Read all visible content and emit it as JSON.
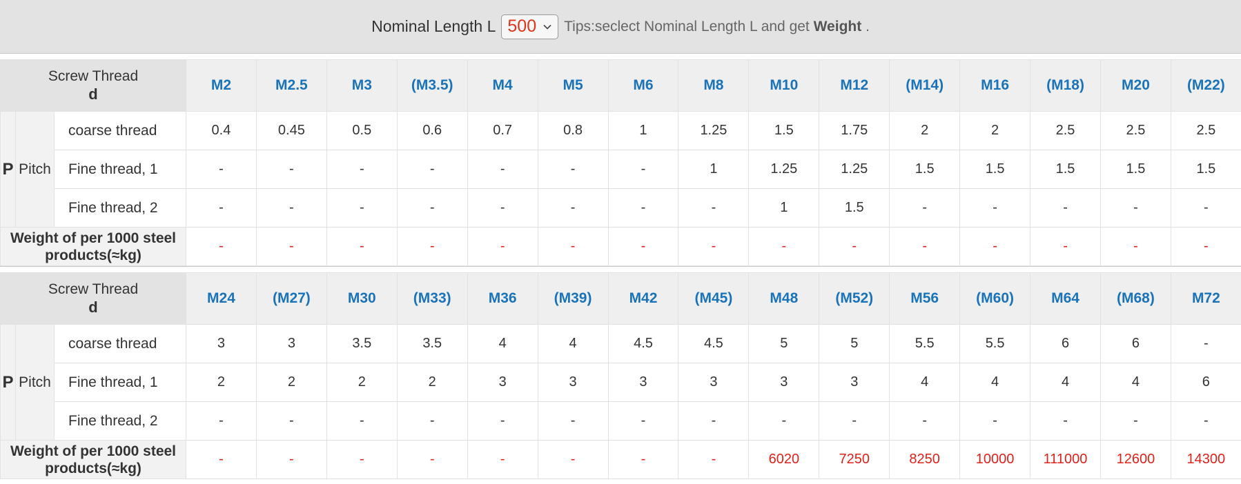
{
  "header": {
    "nominal_length_label": "Nominal Length L",
    "selected_length": "500",
    "tips_prefix": "Tips:seclect Nominal Length L and get",
    "tips_bold": "Weight",
    "tips_suffix": "."
  },
  "row_labels": {
    "screw_thread": "Screw Thread",
    "d": "d",
    "p": "P",
    "pitch": "Pitch",
    "coarse": "coarse thread",
    "fine1": "Fine thread, 1",
    "fine2": "Fine thread, 2",
    "weight": "Weight of per 1000 steel products(≈kg)"
  },
  "tables": [
    {
      "sizes": [
        "M2",
        "M2.5",
        "M3",
        "(M3.5)",
        "M4",
        "M5",
        "M6",
        "M8",
        "M10",
        "M12",
        "(M14)",
        "M16",
        "(M18)",
        "M20",
        "(M22)"
      ],
      "coarse": [
        "0.4",
        "0.45",
        "0.5",
        "0.6",
        "0.7",
        "0.8",
        "1",
        "1.25",
        "1.5",
        "1.75",
        "2",
        "2",
        "2.5",
        "2.5",
        "2.5"
      ],
      "fine1": [
        "-",
        "-",
        "-",
        "-",
        "-",
        "-",
        "-",
        "1",
        "1.25",
        "1.25",
        "1.5",
        "1.5",
        "1.5",
        "1.5",
        "1.5"
      ],
      "fine2": [
        "-",
        "-",
        "-",
        "-",
        "-",
        "-",
        "-",
        "-",
        "1",
        "1.5",
        "-",
        "-",
        "-",
        "-",
        "-"
      ],
      "weight": [
        "-",
        "-",
        "-",
        "-",
        "-",
        "-",
        "-",
        "-",
        "-",
        "-",
        "-",
        "-",
        "-",
        "-",
        "-"
      ]
    },
    {
      "sizes": [
        "M24",
        "(M27)",
        "M30",
        "(M33)",
        "M36",
        "(M39)",
        "M42",
        "(M45)",
        "M48",
        "(M52)",
        "M56",
        "(M60)",
        "M64",
        "(M68)",
        "M72"
      ],
      "coarse": [
        "3",
        "3",
        "3.5",
        "3.5",
        "4",
        "4",
        "4.5",
        "4.5",
        "5",
        "5",
        "5.5",
        "5.5",
        "6",
        "6",
        "-"
      ],
      "fine1": [
        "2",
        "2",
        "2",
        "2",
        "3",
        "3",
        "3",
        "3",
        "3",
        "3",
        "4",
        "4",
        "4",
        "4",
        "6"
      ],
      "fine2": [
        "-",
        "-",
        "-",
        "-",
        "-",
        "-",
        "-",
        "-",
        "-",
        "-",
        "-",
        "-",
        "-",
        "-",
        "-"
      ],
      "weight": [
        "-",
        "-",
        "-",
        "-",
        "-",
        "-",
        "-",
        "-",
        "6020",
        "7250",
        "8250",
        "10000",
        "111000",
        "12600",
        "14300"
      ]
    }
  ]
}
